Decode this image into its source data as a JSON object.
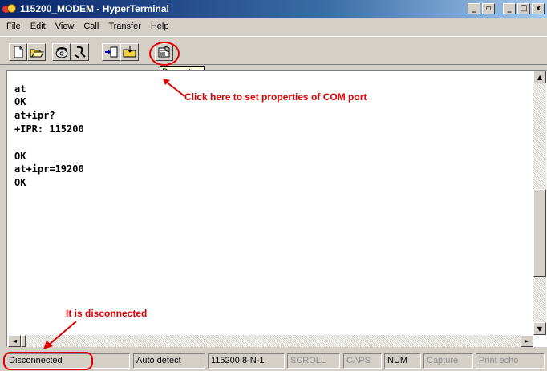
{
  "window": {
    "title": "115200_MODEM - HyperTerminal",
    "controls": {
      "inner_min": "_",
      "inner_restore": "▫",
      "min": "_",
      "max": "□",
      "close": "x"
    }
  },
  "menu": {
    "items": [
      "File",
      "Edit",
      "View",
      "Call",
      "Transfer",
      "Help"
    ]
  },
  "toolbar": {
    "buttons": [
      "new-icon",
      "open-icon",
      "connect-phone-icon",
      "disconnect-phone-icon",
      "send-icon",
      "receive-icon",
      "properties-icon"
    ],
    "tooltip": "Properties"
  },
  "terminal": {
    "lines": [
      "at",
      "OK",
      "at+ipr?",
      "+IPR: 115200",
      "",
      "OK",
      "at+ipr=19200",
      "OK"
    ]
  },
  "annotations": {
    "properties_hint": "Click here to set properties of COM port",
    "disconnected_hint": "It is disconnected",
    "color": "#e00000"
  },
  "statusbar": {
    "connection": "Disconnected",
    "detect": "Auto detect",
    "settings": "115200 8-N-1",
    "scroll": "SCROLL",
    "caps": "CAPS",
    "num": "NUM",
    "capture": "Capture",
    "print_echo": "Print echo"
  },
  "scrollbars": {
    "up": "▲",
    "down": "▼",
    "left": "◄",
    "right": "►"
  }
}
